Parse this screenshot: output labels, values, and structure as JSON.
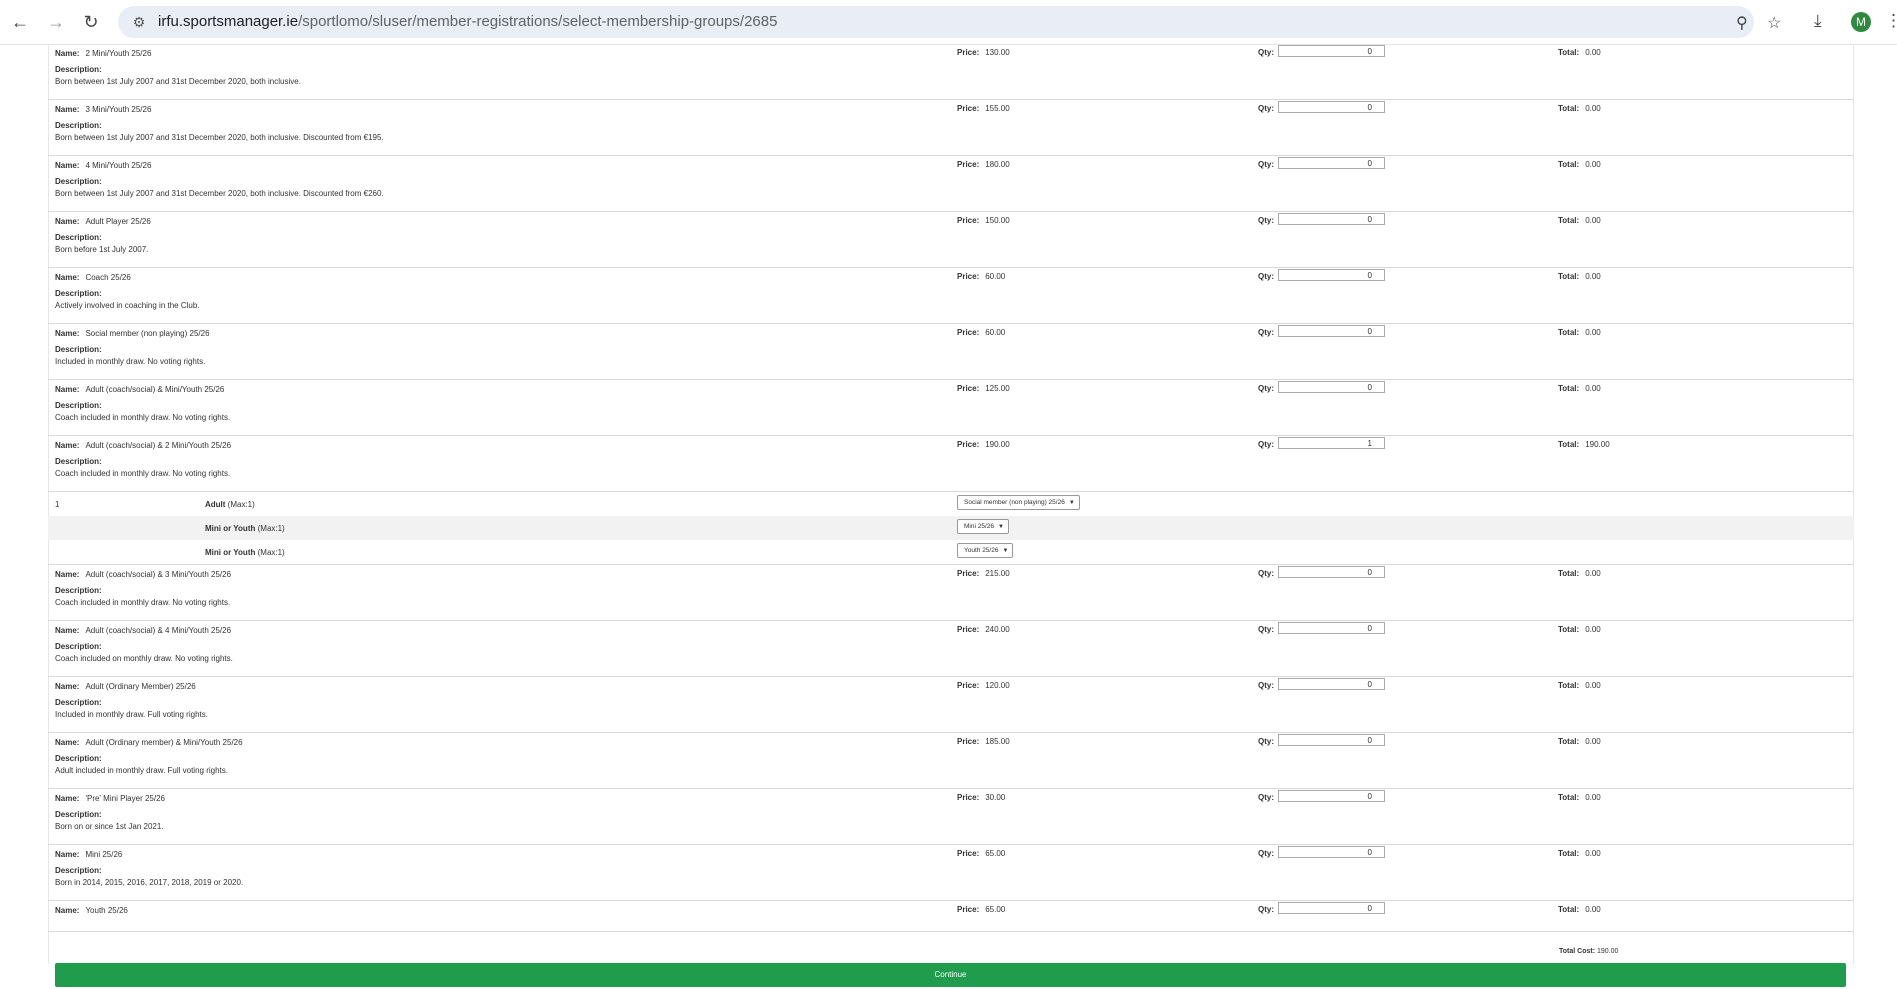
{
  "browser": {
    "url_host": "irfu.sportsmanager.ie",
    "url_path": "/sportlomo/sluser/member-registrations/select-membership-groups/2685",
    "avatar_letter": "M"
  },
  "labels": {
    "name": "Name:",
    "description": "Description:",
    "price": "Price:",
    "qty": "Qty:",
    "total": "Total:",
    "total_cost": "Total Cost:"
  },
  "items": [
    {
      "name": "2 Mini/Youth 25/26",
      "description": "Born between 1st July 2007 and 31st December 2020, both inclusive.",
      "price": "130.00",
      "qty": "0",
      "total": "0.00"
    },
    {
      "name": "3 Mini/Youth 25/26",
      "description": "Born between 1st July 2007 and 31st December 2020, both inclusive. Discounted from €195.",
      "price": "155.00",
      "qty": "0",
      "total": "0.00"
    },
    {
      "name": "4 Mini/Youth 25/26",
      "description": "Born between 1st July 2007 and 31st December 2020, both inclusive. Discounted from €260.",
      "price": "180.00",
      "qty": "0",
      "total": "0.00"
    },
    {
      "name": "Adult Player 25/26",
      "description": "Born before 1st July 2007.",
      "price": "150.00",
      "qty": "0",
      "total": "0.00"
    },
    {
      "name": "Coach 25/26",
      "description": "Actively involved in coaching in the Club.",
      "price": "60.00",
      "qty": "0",
      "total": "0.00"
    },
    {
      "name": "Social member (non playing) 25/26",
      "description": "Included in monthly draw. No voting rights.",
      "price": "60.00",
      "qty": "0",
      "total": "0.00"
    },
    {
      "name": "Adult (coach/social) & Mini/Youth 25/26",
      "description": "Coach included in monthly draw. No voting rights.",
      "price": "125.00",
      "qty": "0",
      "total": "0.00"
    },
    {
      "name": "Adult (coach/social) & 2 Mini/Youth 25/26",
      "description": "Coach included in monthly draw. No voting rights.",
      "price": "190.00",
      "qty": "1",
      "total": "190.00"
    }
  ],
  "selection": {
    "number": "1",
    "rows": [
      {
        "label": "Adult",
        "max": "(Max:1)",
        "selected": "Social member (non playing) 25/26"
      },
      {
        "label": "Mini or Youth",
        "max": "(Max:1)",
        "selected": "Mini 25/26"
      },
      {
        "label": "Mini or Youth",
        "max": "(Max:1)",
        "selected": "Youth 25/26"
      }
    ]
  },
  "items2": [
    {
      "name": "Adult (coach/social) & 3 Mini/Youth 25/26",
      "description": "Coach included in monthly draw. No voting rights.",
      "price": "215.00",
      "qty": "0",
      "total": "0.00"
    },
    {
      "name": "Adult (coach/social) & 4 Mini/Youth 25/26",
      "description": "Coach included on monthly draw. No voting rights.",
      "price": "240.00",
      "qty": "0",
      "total": "0.00"
    },
    {
      "name": "Adult (Ordinary Member) 25/26",
      "description": "Included in monthly draw. Full voting rights.",
      "price": "120.00",
      "qty": "0",
      "total": "0.00"
    },
    {
      "name": "Adult (Ordinary member) & Mini/Youth 25/26",
      "description": "Adult included in monthly draw. Full voting rights.",
      "price": "185.00",
      "qty": "0",
      "total": "0.00"
    },
    {
      "name": "'Pre' Mini Player 25/26",
      "description": "Born on or since 1st Jan 2021.",
      "price": "30.00",
      "qty": "0",
      "total": "0.00"
    },
    {
      "name": "Mini 25/26",
      "description": "Born in 2014, 2015, 2016, 2017, 2018, 2019 or 2020.",
      "price": "65.00",
      "qty": "0",
      "total": "0.00"
    },
    {
      "name": "Youth 25/26",
      "description": "",
      "price": "65.00",
      "qty": "0",
      "total": "0.00"
    }
  ],
  "total_cost": "190.00",
  "continue_label": "Continue",
  "colors": {
    "continue_bg": "#1f9d4d",
    "avatar_bg": "#2e8b3e"
  }
}
